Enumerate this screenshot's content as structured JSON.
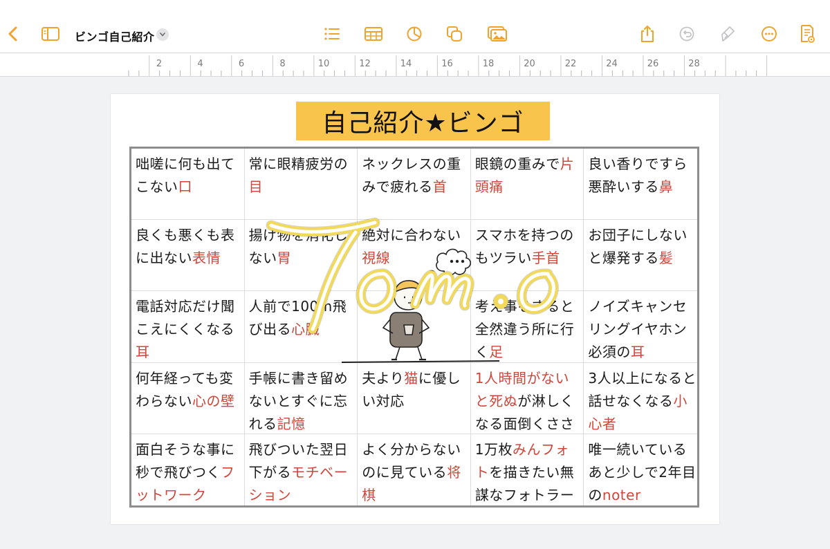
{
  "toolbar": {
    "document_title": "ビンゴ自己紹介",
    "icons": [
      "back-chevron-icon",
      "sidebar-icon",
      "list-icon",
      "table-icon",
      "chart-icon",
      "shapes-icon",
      "media-icon",
      "share-icon",
      "undo-icon",
      "format-brush-icon",
      "more-icon",
      "document-options-icon"
    ],
    "accent_color": "#f0a22d"
  },
  "ruler": {
    "marks": [
      "2",
      "4",
      "6",
      "8",
      "10",
      "12",
      "14",
      "16",
      "18",
      "20",
      "22",
      "24",
      "26",
      "28"
    ]
  },
  "document": {
    "heading": "自己紹介★ビンゴ",
    "heading_bg": "#f8c44c",
    "highlight_color": "#d0463b",
    "bingo": [
      {
        "plain": "咄嗟に何も出てこない",
        "red": "口"
      },
      {
        "plain": "常に眼精疲労の",
        "red": "目"
      },
      {
        "plain": "ネックレスの重みで疲れる",
        "red": "首"
      },
      {
        "plain": "眼鏡の重みで",
        "red": "片頭痛"
      },
      {
        "plain": "良い香りですら悪酔いする",
        "red": "鼻"
      },
      {
        "plain": "良くも悪くも表に出ない",
        "red": "表情"
      },
      {
        "plain": "揚げ物を消化しない",
        "red": "胃"
      },
      {
        "plain": "絶対に合わない",
        "red": "視線"
      },
      {
        "plain": "スマホを持つのもツラい",
        "red": "手首"
      },
      {
        "plain": "お団子にしないと爆発する",
        "red": "髪"
      },
      {
        "plain": "電話対応だけ聞こえにくくなる",
        "red": "耳"
      },
      {
        "plain": "人前で100m飛び出る",
        "red": "心臓"
      },
      {
        "plain": "",
        "red": ""
      },
      {
        "plain": "考え事をすると全然違う所に行く",
        "red": "足"
      },
      {
        "plain": "ノイズキャンセリングイヤホン必須の",
        "red": "耳"
      },
      {
        "plain": "何年経っても変わらない",
        "red": "心の壁"
      },
      {
        "plain": "手帳に書き留めないとすぐに忘れる",
        "red": "記憶"
      },
      {
        "plain": "夫より",
        "red": "猫",
        "tail": "に優しい対応"
      },
      {
        "plain": "",
        "red": "1人時間がないと死ぬ",
        "tail": "が淋しくなる面倒くささ"
      },
      {
        "plain": "3人以上になると話せなくなる",
        "red": "小心者"
      },
      {
        "plain": "面白そうな事に秒で飛びつく",
        "red": "フットワーク"
      },
      {
        "plain": "飛びついた翌日下がる",
        "red": "モチベーション"
      },
      {
        "plain": "よく分からないのに見ている",
        "red": "将棋"
      },
      {
        "plain": "1万枚",
        "red": "みんフォト",
        "tail": "を描きたい無謀なフォトラー"
      },
      {
        "plain": "唯一続いているあと少しで2年目の",
        "red": "noter"
      }
    ],
    "overlay_signature": "Tomo",
    "signature_color": "#f1d95c"
  }
}
